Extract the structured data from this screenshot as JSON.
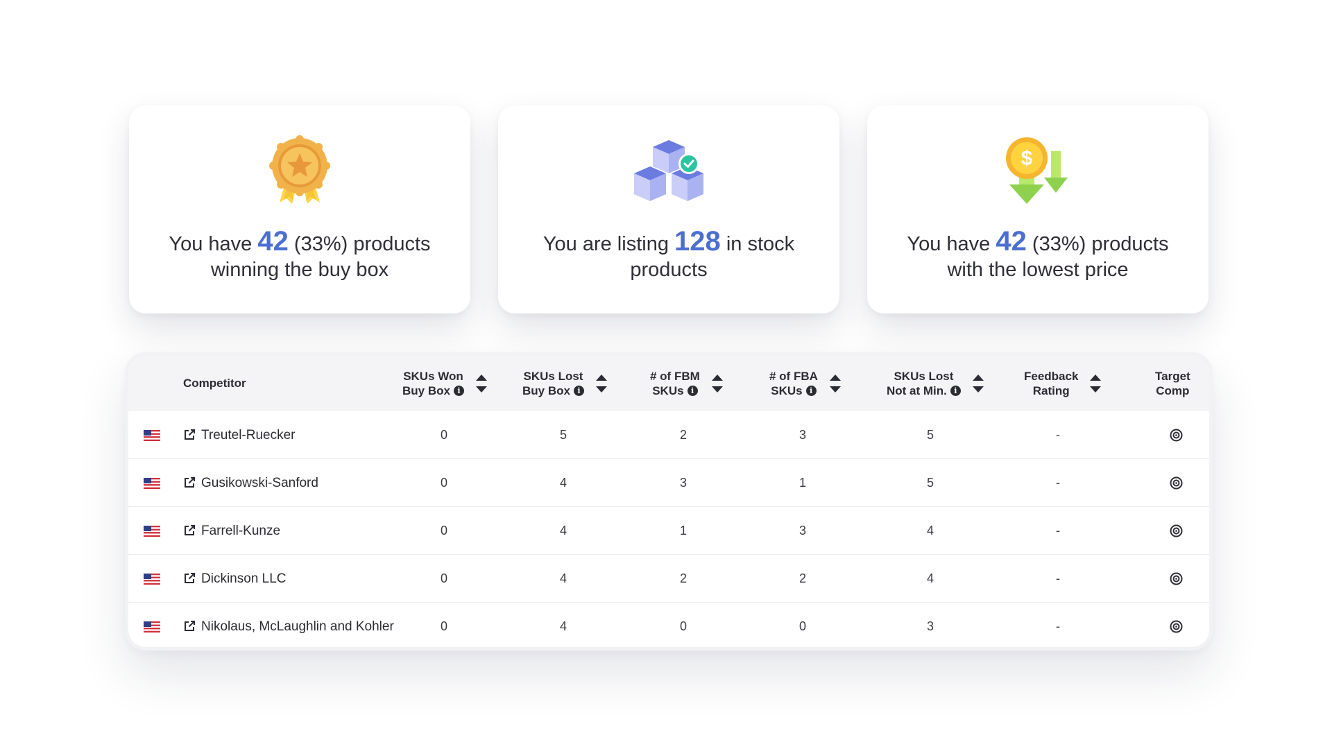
{
  "stat_cards": [
    {
      "pre": "You have ",
      "number": "42",
      "post": " (33%) products winning the buy box",
      "icon": "award-medal-icon"
    },
    {
      "pre": "You are listing ",
      "number": "128",
      "post": " in stock products",
      "icon": "stock-boxes-check-icon"
    },
    {
      "pre": "You have ",
      "number": "42",
      "post": " (33%) products with the lowest price",
      "icon": "price-down-arrows-icon"
    }
  ],
  "table": {
    "columns": {
      "competitor": "Competitor",
      "skus_won": [
        "SKUs Won",
        "Buy Box"
      ],
      "skus_lost": [
        "SKUs Lost",
        "Buy Box"
      ],
      "fbm": [
        "# of FBM",
        "SKUs"
      ],
      "fba": [
        "# of FBA",
        "SKUs"
      ],
      "not_min": [
        "SKUs Lost",
        "Not at Min."
      ],
      "feedback": [
        "Feedback",
        "Rating"
      ],
      "target": [
        "Target",
        "Comp"
      ]
    },
    "rows": [
      {
        "name": "Treutel-Ruecker",
        "won": "0",
        "lost": "5",
        "fbm": "2",
        "fba": "3",
        "not_min": "5",
        "feedback": "-"
      },
      {
        "name": "Gusikowski-Sanford",
        "won": "0",
        "lost": "4",
        "fbm": "3",
        "fba": "1",
        "not_min": "5",
        "feedback": "-"
      },
      {
        "name": "Farrell-Kunze",
        "won": "0",
        "lost": "4",
        "fbm": "1",
        "fba": "3",
        "not_min": "4",
        "feedback": "-"
      },
      {
        "name": "Dickinson LLC",
        "won": "0",
        "lost": "4",
        "fbm": "2",
        "fba": "2",
        "not_min": "4",
        "feedback": "-"
      },
      {
        "name": "Nikolaus, McLaughlin and Kohler",
        "won": "0",
        "lost": "4",
        "fbm": "0",
        "fba": "0",
        "not_min": "3",
        "feedback": "-"
      }
    ],
    "row_icons": {
      "flag": "us-flag-icon",
      "link": "external-link-icon",
      "target": "target-icon"
    }
  },
  "colors": {
    "accent": "#4b6fd1",
    "header_bg": "#f4f4f6",
    "text": "#2b2b33"
  }
}
